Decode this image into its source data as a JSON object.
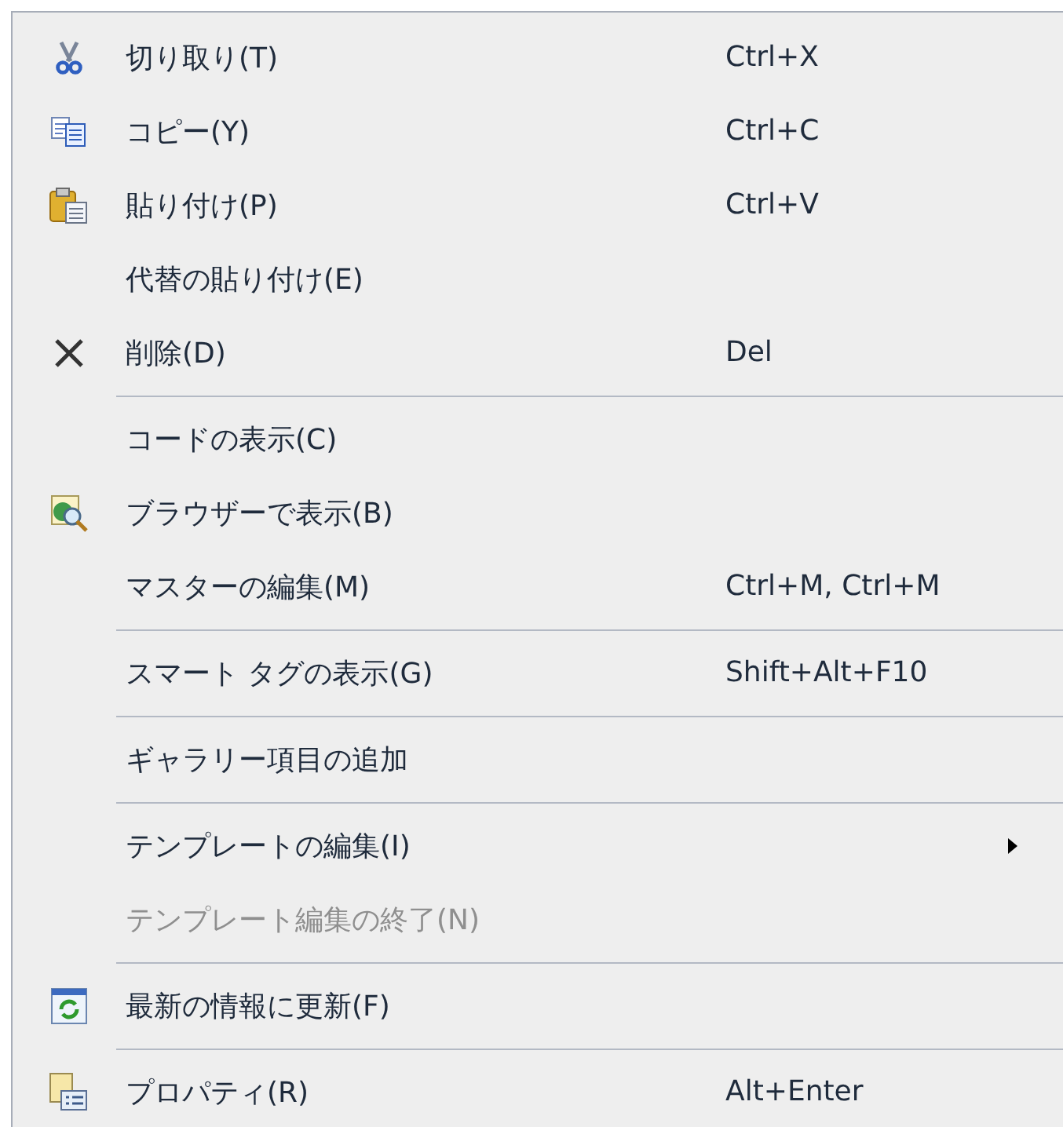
{
  "menu": {
    "groups": [
      {
        "items": [
          {
            "label": "切り取り(T)",
            "shortcut": "Ctrl+X",
            "disabled": false,
            "submenu": false
          },
          {
            "label": "コピー(Y)",
            "shortcut": "Ctrl+C",
            "disabled": false,
            "submenu": false
          },
          {
            "label": "貼り付け(P)",
            "shortcut": "Ctrl+V",
            "disabled": false,
            "submenu": false
          },
          {
            "label": "代替の貼り付け(E)",
            "disabled": false,
            "submenu": false
          },
          {
            "label": "削除(D)",
            "shortcut": "Del",
            "disabled": false,
            "submenu": false
          }
        ]
      },
      {
        "items": [
          {
            "label": "コードの表示(C)",
            "disabled": false,
            "submenu": false
          },
          {
            "label": "ブラウザーで表示(B)",
            "disabled": false,
            "submenu": false
          },
          {
            "label": "マスターの編集(M)",
            "shortcut": "Ctrl+M, Ctrl+M",
            "disabled": false,
            "submenu": false
          }
        ]
      },
      {
        "items": [
          {
            "label": "スマート タグの表示(G)",
            "shortcut": "Shift+Alt+F10",
            "disabled": false,
            "submenu": false
          }
        ]
      },
      {
        "items": [
          {
            "label": "ギャラリー項目の追加",
            "disabled": false,
            "submenu": false
          }
        ]
      },
      {
        "items": [
          {
            "label": "テンプレートの編集(I)",
            "disabled": false,
            "submenu": true
          },
          {
            "label": "テンプレート編集の終了(N)",
            "disabled": true,
            "submenu": false
          }
        ]
      },
      {
        "items": [
          {
            "label": "最新の情報に更新(F)",
            "disabled": false,
            "submenu": false
          }
        ]
      },
      {
        "items": [
          {
            "label": "プロパティ(R)",
            "shortcut": "Alt+Enter",
            "disabled": false,
            "submenu": false
          }
        ]
      }
    ]
  }
}
